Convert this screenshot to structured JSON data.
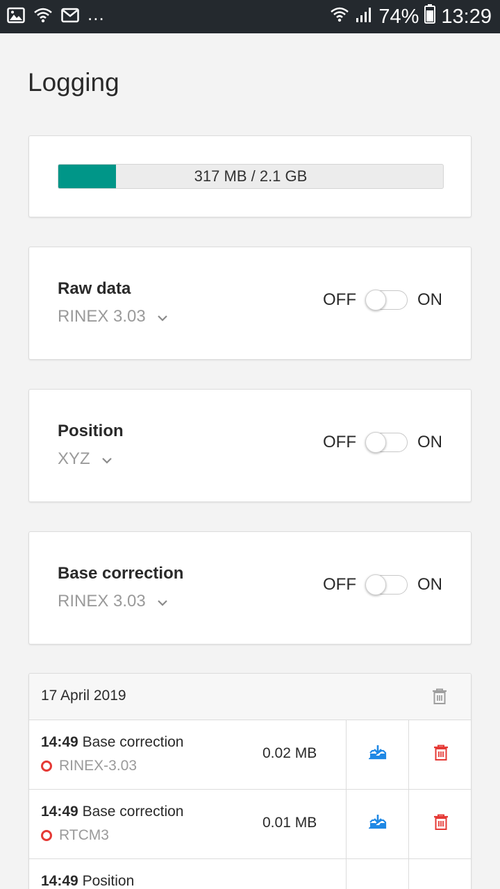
{
  "status_bar": {
    "dots": "...",
    "battery_percent": "74%",
    "time": "13:29",
    "icons_left": [
      "image-icon",
      "wifi-icon",
      "mail-icon"
    ],
    "icons_right": [
      "wifi-icon",
      "signal-icon",
      "battery-icon"
    ]
  },
  "page": {
    "title": "Logging"
  },
  "storage": {
    "used_label": "317 MB / 2.1 GB",
    "used_fraction": 0.15,
    "fill_color": "#009688"
  },
  "log_settings": [
    {
      "title": "Raw data",
      "format": "RINEX 3.03",
      "off_label": "OFF",
      "on_label": "ON",
      "enabled": false
    },
    {
      "title": "Position",
      "format": "XYZ",
      "off_label": "OFF",
      "on_label": "ON",
      "enabled": false
    },
    {
      "title": "Base correction",
      "format": "RINEX 3.03",
      "off_label": "OFF",
      "on_label": "ON",
      "enabled": false
    }
  ],
  "files": {
    "date": "17 April 2019",
    "rows": [
      {
        "time": "14:49",
        "name": "Base correction",
        "format": "RINEX-3.03",
        "size": "0.02 MB"
      },
      {
        "time": "14:49",
        "name": "Base correction",
        "format": "RTCM3",
        "size": "0.01 MB"
      },
      {
        "time": "14:49",
        "name": "Position",
        "format": "",
        "size": ""
      }
    ]
  },
  "colors": {
    "accent": "#009688",
    "download": "#1e88e5",
    "delete": "#e53935",
    "status_bar": "#24292e"
  }
}
